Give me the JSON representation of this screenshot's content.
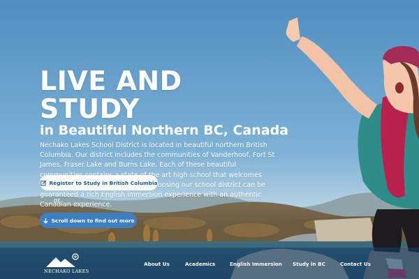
{
  "hero": {
    "title": "LIVE AND STUDY",
    "subtitle": "in Beautiful Northern BC, Canada",
    "body": "Nechako Lakes School District is located in beautiful northern British Columbia. Our district includes the communities of Vanderhoof, Fort St James, Fraser Lake and Burns Lake. Each of these beautiful communities contains a state of the art high school that welcomes International Students. Students choosing our school district can be guaranteed a rich English immersion experience with an authentic Canadian experience."
  },
  "buttons": {
    "register_label": "Register to Study in British Columbia",
    "register_icon": "edit-icon",
    "or_text": "or",
    "scroll_label": "Scroll down to find out more",
    "scroll_icon": "arrow-down-icon"
  },
  "nav": {
    "logo_text": "NECHAKO LAKES",
    "items": [
      {
        "label": "About Us"
      },
      {
        "label": "Academics"
      },
      {
        "label": "English Immersion"
      },
      {
        "label": "Study in BC"
      },
      {
        "label": "Contact Us"
      }
    ]
  },
  "colors": {
    "sky": "#5b97c6",
    "nav_overlay": "#163e68",
    "scroll_button": "#3d7fc1",
    "register_text": "#1d5a8f"
  }
}
